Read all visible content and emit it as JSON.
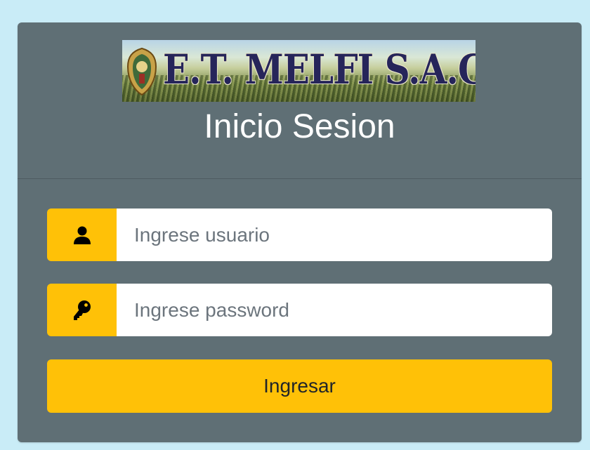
{
  "logo": {
    "text": "E.T. MELFI S.A.C."
  },
  "header": {
    "title": "Inicio Sesion"
  },
  "form": {
    "username": {
      "icon": "user-icon",
      "placeholder": "Ingrese usuario",
      "value": ""
    },
    "password": {
      "icon": "key-icon",
      "placeholder": "Ingrese password",
      "value": ""
    },
    "submit_label": "Ingresar"
  },
  "colors": {
    "page_background": "#c9ecf7",
    "card_background": "#5f6f75",
    "accent": "#ffc107",
    "title_text": "#ffffff"
  }
}
